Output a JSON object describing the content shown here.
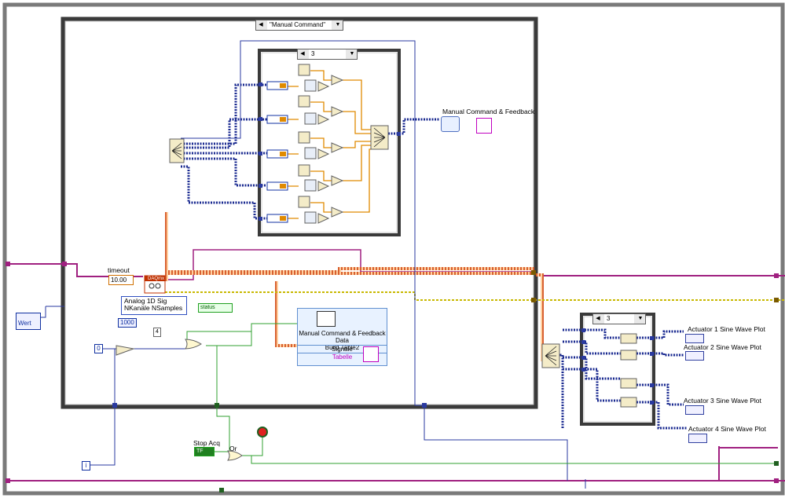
{
  "case_selector": {
    "value": "\"Manual Command\""
  },
  "inner_case_top": {
    "value": "3"
  },
  "inner_case_right": {
    "value": "3"
  },
  "labels": {
    "manual_cmd_feedback": "Manual Command & Feedback",
    "timeout": "timeout",
    "stop_acq": "Stop Acq",
    "or": "Or",
    "status": "status",
    "build_table_title_1": "Manual Command & Feedback Data",
    "build_table_title_2": "Build Table2",
    "signale": "Signale",
    "tabelle": "Tabelle",
    "actuator1": "Actuator 1 Sine Wave Plot",
    "actuator2": "Actuator 2 Sine Wave Plot",
    "actuator3": "Actuator 3 Sine Wave Plot",
    "actuator4": "Actuator 4 Sine Wave Plot"
  },
  "controls": {
    "timeout_value": "10.00",
    "analog_line1": "Analog 1D Sig",
    "analog_line2": "NKanäle NSamples",
    "samples_value": "1000",
    "wert": "Wert",
    "zero": "0",
    "four": "4",
    "iter": "i",
    "tf": "TF",
    "daqmx": "DAQmx"
  },
  "colors": {
    "block_frame": "#2a2a2a",
    "error_wire": "#c03000",
    "dbl_wire": "#e08a00",
    "array_wire": "#1a2a90",
    "cluster_wire": "#a02080",
    "bool_wire": "#30a030",
    "task_wire": "#d4c400"
  }
}
